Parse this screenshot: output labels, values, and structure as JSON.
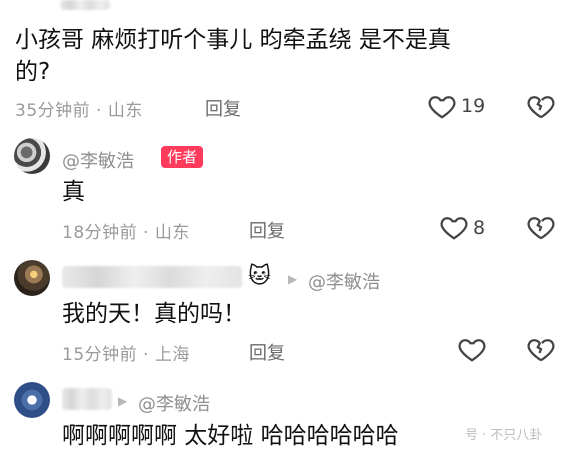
{
  "comments": [
    {
      "text_line1": "小孩哥  麻烦打听个事儿   昀牵孟绕  是不是真",
      "text_line2": "的?",
      "meta": "35分钟前 · 山东",
      "reply_label": "回复",
      "like_count": "19"
    },
    {
      "name": "@李敏浩",
      "badge": "作者",
      "text": "真",
      "meta": "18分钟前 · 山东",
      "reply_label": "回复",
      "like_count": "8"
    },
    {
      "reply_to": "@李敏浩",
      "text": "我的天！真的吗！",
      "meta": "15分钟前 · 上海",
      "reply_label": "回复"
    },
    {
      "reply_to": "@李敏浩",
      "text": "啊啊啊啊啊  太好啦  哈哈哈哈哈哈"
    }
  ],
  "watermark": "号 · 不只八卦",
  "icons": {
    "like": "heart-outline-icon",
    "dislike": "broken-heart-icon",
    "reply_arrow": "triangle-right-icon",
    "cat_emoji": "cat-face-emoji"
  }
}
